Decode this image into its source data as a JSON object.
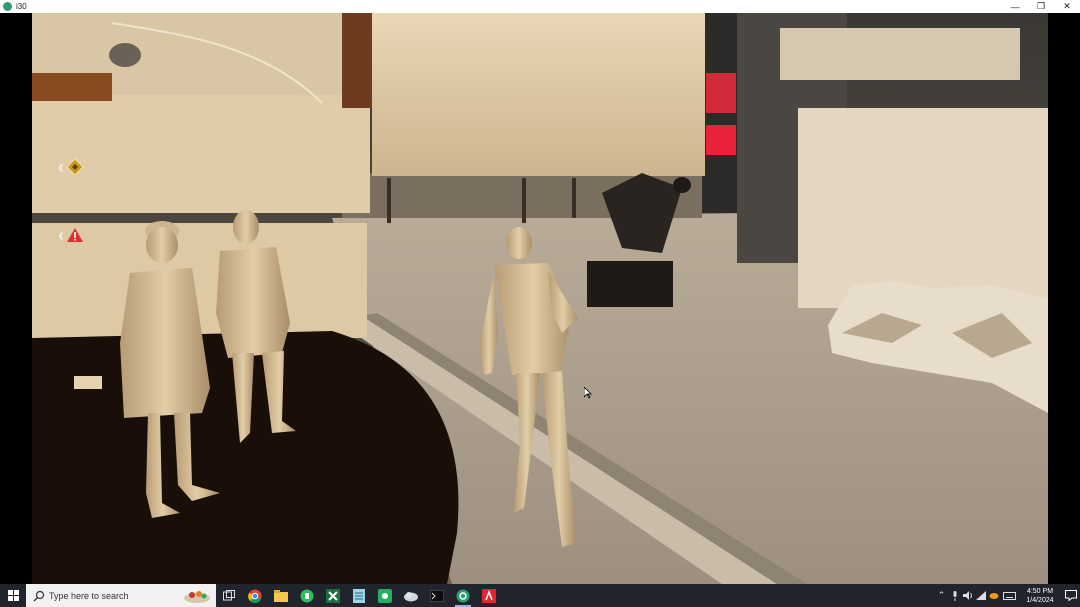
{
  "window": {
    "title": "i30",
    "minimize": "—",
    "maximize": "❐",
    "close": "✕"
  },
  "game": {
    "hud": [
      {
        "icon": "diamond-objective-icon",
        "color": "#c99a1c"
      },
      {
        "icon": "warning-triangle-icon",
        "color": "#e03030"
      }
    ]
  },
  "taskbar": {
    "search_placeholder": "Type here to search",
    "apps": [
      "task-view-icon",
      "chrome-icon",
      "file-explorer-icon",
      "evernote-icon",
      "excel-icon",
      "notepad-icon",
      "green-app-icon",
      "cloud-icon",
      "terminal-icon",
      "active-app-icon",
      "red-app-icon"
    ],
    "clock": {
      "time": "4:50 PM",
      "date": "1/4/2024"
    }
  }
}
